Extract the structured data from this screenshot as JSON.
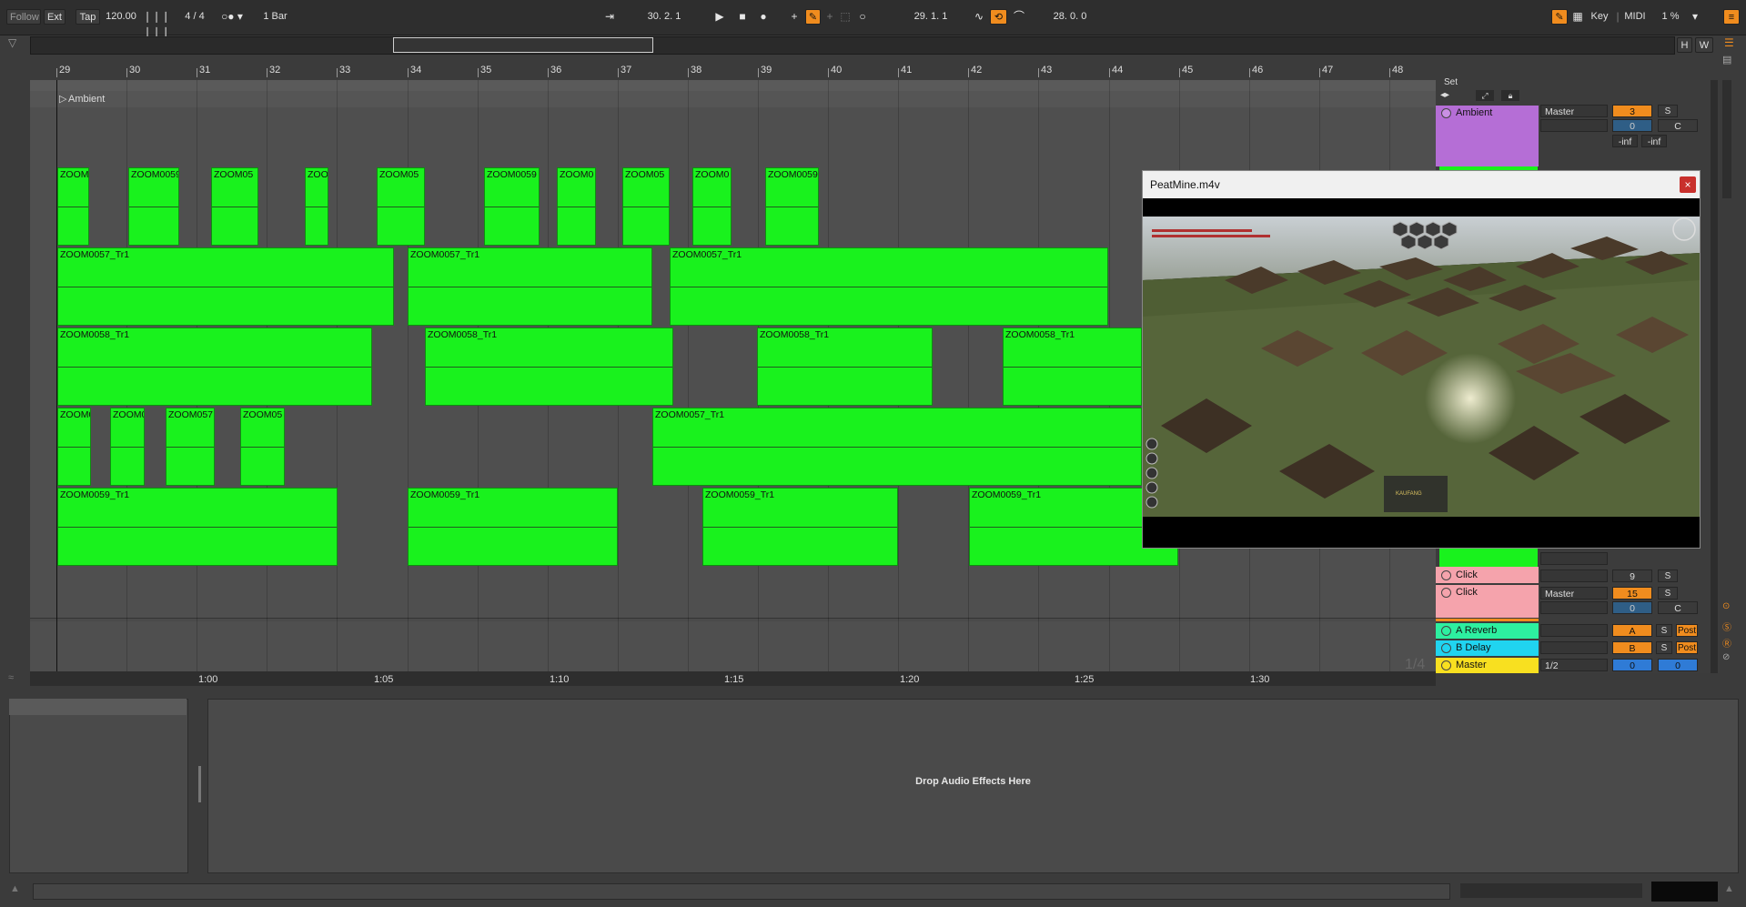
{
  "topbar": {
    "follow": "Follow",
    "ext": "Ext",
    "tap": "Tap",
    "tempo": "120.00",
    "time_signature": "4 / 4",
    "quantize": "1 Bar",
    "arrangement_position": "30.   2.   1",
    "loop_start": "29.   1.   1",
    "loop_length": "28.   0.   0",
    "key": "Key",
    "midi": "MIDI",
    "cpu": "1 %",
    "h_btn": "H",
    "w_btn": "W"
  },
  "ruler": {
    "bars": [
      "29",
      "30",
      "31",
      "32",
      "33",
      "34",
      "35",
      "36",
      "37",
      "38",
      "39",
      "40",
      "41",
      "42",
      "43",
      "44",
      "45",
      "46",
      "47",
      "48"
    ]
  },
  "tracks": {
    "ambient_label": "Ambient"
  },
  "clips": {
    "lane1": [
      "ZOOM0",
      "ZOOM0059",
      "ZOOM05",
      "ZOO",
      "ZOOM05",
      "ZOOM0059",
      "ZOOM0",
      "ZOOM05",
      "ZOOM0",
      "ZOOM0059"
    ],
    "lane2": [
      "ZOOM0057_Tr1",
      "ZOOM0057_Tr1",
      "ZOOM0057_Tr1"
    ],
    "lane3": [
      "ZOOM0058_Tr1",
      "ZOOM0058_Tr1",
      "ZOOM0058_Tr1",
      "ZOOM0058_Tr1"
    ],
    "lane4": [
      "ZOOM0",
      "ZOOM0",
      "ZOOM057",
      "ZOOM05",
      "ZOOM0057_Tr1"
    ],
    "lane5": [
      "ZOOM0059_Tr1",
      "ZOOM0059_Tr1",
      "ZOOM0059_Tr1",
      "ZOOM0059_Tr1"
    ]
  },
  "mixer": {
    "set_label": "Set",
    "ambient": {
      "name": "Ambient",
      "output": "Master",
      "number": "3",
      "solo": "S",
      "volume": "0",
      "pan": "C",
      "peak_l": "-inf",
      "peak_r": "-inf"
    },
    "click1": {
      "name": "Click",
      "number": "9",
      "solo": "S"
    },
    "click2": {
      "name": "Click",
      "output": "Master",
      "number": "15",
      "solo": "S",
      "volume": "0",
      "pan": "C"
    },
    "reverb": {
      "name": "A Reverb",
      "send": "A",
      "solo": "S",
      "post": "Post"
    },
    "delay": {
      "name": "B Delay",
      "send": "B",
      "solo": "S",
      "post": "Post"
    },
    "master": {
      "name": "Master",
      "cue": "1/2",
      "volume": "0",
      "pan": "0"
    },
    "zoom_label": "1/4"
  },
  "timeline": {
    "marks": [
      "1:00",
      "1:05",
      "1:10",
      "1:15",
      "1:20",
      "1:25",
      "1:30"
    ]
  },
  "detail": {
    "drop_text": "Drop Audio Effects Here"
  },
  "video": {
    "title": "PeatMine.m4v",
    "close": "×",
    "hud_label": "KAUFANG"
  },
  "colors": {
    "clip": "#19f21d",
    "ambient_track": "#b56ed6",
    "click_track": "#f5a3ac",
    "reverb_track": "#2df0a0",
    "delay_track": "#20d4f0",
    "master_track": "#f8e020",
    "accent": "#f08c1e"
  }
}
